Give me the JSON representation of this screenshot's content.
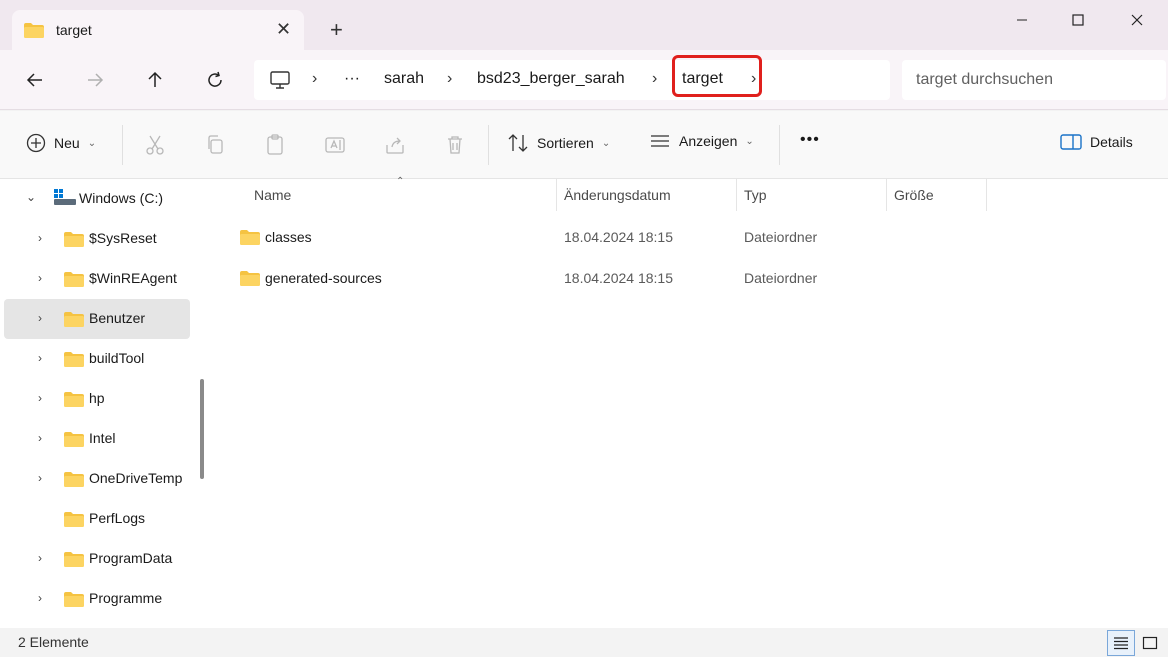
{
  "window": {
    "tab_title": "target",
    "new_tab_symbol": "+",
    "close_tab_symbol": "✕"
  },
  "navigation": {
    "breadcrumb": [
      "sarah",
      "bsd23_berger_sarah",
      "target"
    ],
    "overflow": "···",
    "search_placeholder": "target durchsuchen"
  },
  "toolbar": {
    "new_label": "Neu",
    "sort_label": "Sortieren",
    "view_label": "Anzeigen",
    "more_label": "•••",
    "details_label": "Details"
  },
  "sidebar": {
    "drive_label": "Windows (C:)",
    "items": [
      {
        "label": "$SysReset",
        "expandable": true
      },
      {
        "label": "$WinREAgent",
        "expandable": true
      },
      {
        "label": "Benutzer",
        "expandable": true,
        "selected": true
      },
      {
        "label": "buildTool",
        "expandable": true
      },
      {
        "label": "hp",
        "expandable": true
      },
      {
        "label": "Intel",
        "expandable": true
      },
      {
        "label": "OneDriveTemp",
        "expandable": true
      },
      {
        "label": "PerfLogs",
        "expandable": false
      },
      {
        "label": "ProgramData",
        "expandable": true
      },
      {
        "label": "Programme",
        "expandable": true
      }
    ]
  },
  "file_list": {
    "columns": [
      "Name",
      "Änderungsdatum",
      "Typ",
      "Größe"
    ],
    "rows": [
      {
        "name": "classes",
        "modified": "18.04.2024 18:15",
        "type": "Dateiordner",
        "size": ""
      },
      {
        "name": "generated-sources",
        "modified": "18.04.2024 18:15",
        "type": "Dateiordner",
        "size": ""
      }
    ]
  },
  "status": {
    "item_count": "2 Elemente"
  },
  "colors": {
    "folder": "#f5c342",
    "highlight": "#e0201d",
    "accent": "#1a73c8"
  }
}
